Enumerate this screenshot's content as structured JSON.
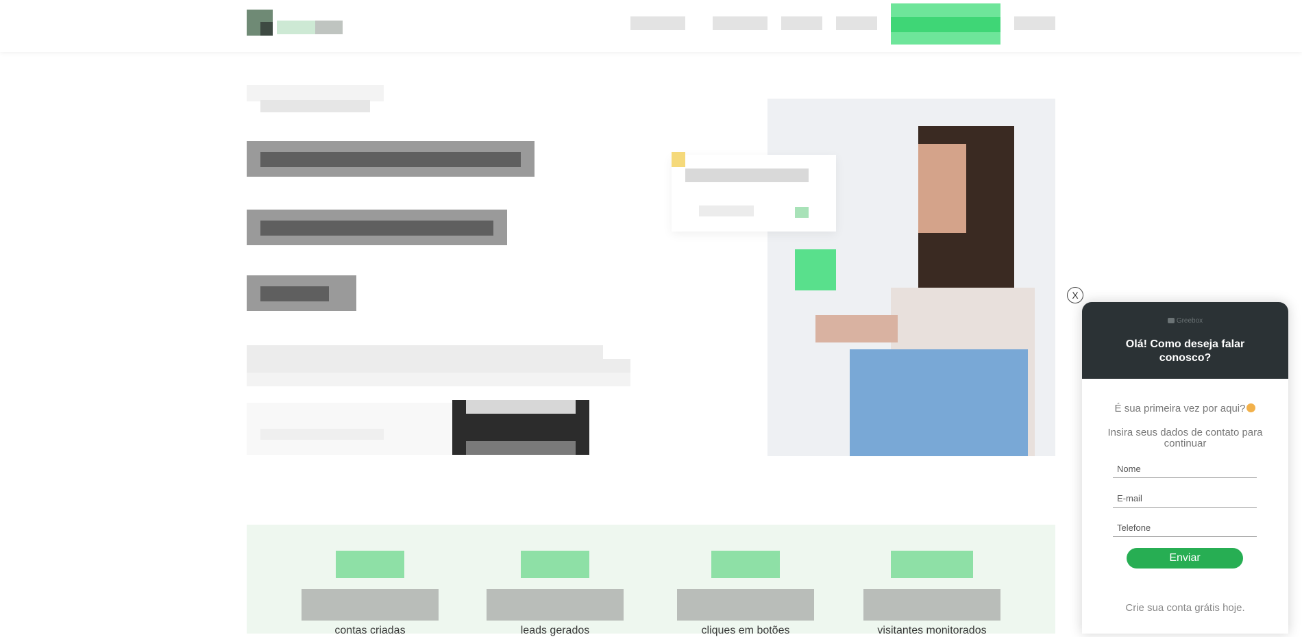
{
  "chat_widget": {
    "close_label": "X",
    "brand": "Greebox",
    "title": "Olá! Como deseja falar conosco?",
    "first_time_question": "É sua primeira vez por aqui?",
    "instruction": "Insira seus dados de contato para continuar",
    "fields": {
      "name_placeholder": "Nome",
      "email_placeholder": "E-mail",
      "phone_placeholder": "Telefone"
    },
    "submit_label": "Enviar",
    "footer_text": "Crie sua conta grátis hoje."
  },
  "stats": [
    {
      "label": "contas criadas"
    },
    {
      "label": "leads gerados"
    },
    {
      "label": "cliques em botões"
    },
    {
      "label": "visitantes monitorados"
    }
  ],
  "colors": {
    "chat_header": "#2b3235",
    "accent_green": "#27ae53",
    "stats_background": "#eef7ef"
  },
  "icons": {
    "chat_close": "close-icon",
    "brand": "chat-bubble-icon",
    "emoji": "upside-down-face-emoji"
  }
}
